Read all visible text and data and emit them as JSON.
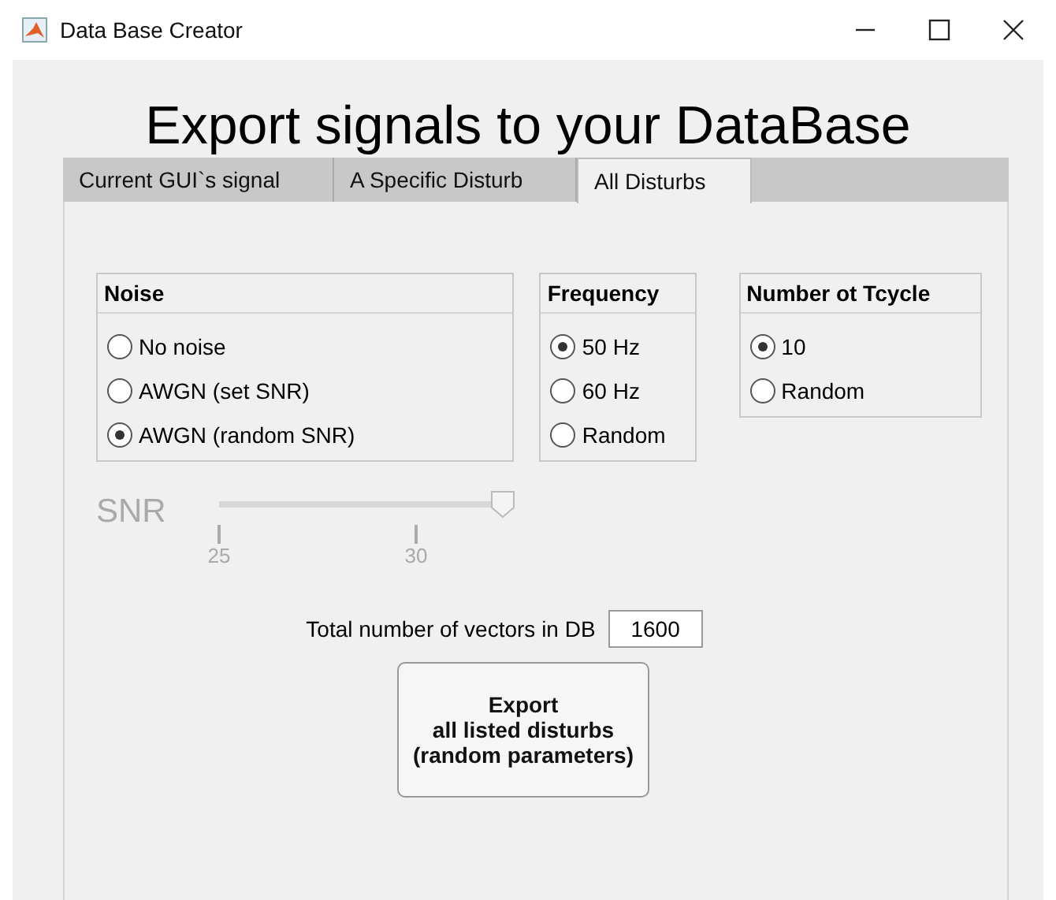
{
  "window": {
    "title": "Data Base Creator"
  },
  "heading": "Export signals to your DataBase",
  "tabs": [
    {
      "label": "Current GUI`s signal",
      "selected": false
    },
    {
      "label": "A Specific Disturb",
      "selected": false
    },
    {
      "label": "All Disturbs",
      "selected": true
    }
  ],
  "groups": [
    {
      "title": "Noise",
      "options": [
        {
          "label": "No noise",
          "selected": false
        },
        {
          "label": "AWGN (set SNR)",
          "selected": false
        },
        {
          "label": "AWGN (random SNR)",
          "selected": true
        }
      ]
    },
    {
      "title": "Frequency",
      "options": [
        {
          "label": "50 Hz",
          "selected": true
        },
        {
          "label": "60 Hz",
          "selected": false
        },
        {
          "label": "Random",
          "selected": false
        }
      ]
    },
    {
      "title": "Number ot Tcycle",
      "options": [
        {
          "label": "10",
          "selected": true
        },
        {
          "label": "Random",
          "selected": false
        }
      ]
    }
  ],
  "snr_slider": {
    "label": "SNR",
    "level": 1,
    "disabled": true,
    "ticks": [
      "25",
      "30"
    ]
  },
  "vectors_field": {
    "label": "Total number of vectors in DB",
    "value": "1600"
  },
  "export_button": {
    "label": "Export\nall listed disturbs\n(random parameters)"
  }
}
